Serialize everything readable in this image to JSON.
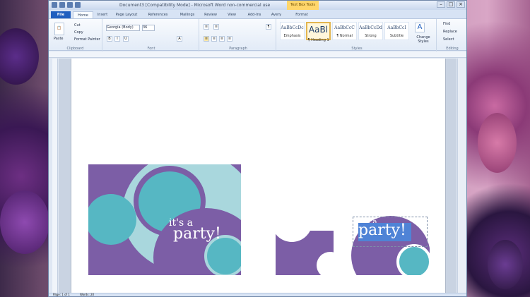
{
  "window": {
    "title": "Document3 [Compatibility Mode] - Microsoft Word non-commercial use",
    "contextual_tab": "Text Box Tools"
  },
  "tabs": [
    "File",
    "Home",
    "Insert",
    "Page Layout",
    "References",
    "Mailings",
    "Review",
    "View",
    "Add-Ins",
    "Avery",
    "Format"
  ],
  "ribbon": {
    "clipboard": {
      "paste": "Paste",
      "cut": "Cut",
      "copy": "Copy",
      "format_painter": "Format Painter",
      "group": "Clipboard"
    },
    "font": {
      "name": "Georgia (Body)",
      "size": "36",
      "group": "Font"
    },
    "paragraph": {
      "group": "Paragraph"
    },
    "styles": {
      "items": [
        {
          "sample": "AaBbCcDc",
          "name": "Emphasis"
        },
        {
          "sample": "AaBl",
          "name": "¶ Heading 1"
        },
        {
          "sample": "AaBbCcC",
          "name": "¶ Normal"
        },
        {
          "sample": "AaBbCcDd",
          "name": "Strong"
        },
        {
          "sample": "AaBbCcI",
          "name": "Subtitle"
        }
      ],
      "change_styles": "Change Styles",
      "group": "Styles"
    },
    "editing": {
      "find": "Find",
      "replace": "Replace",
      "select": "Select",
      "group": "Editing"
    }
  },
  "document": {
    "invitation_text_small": "it's a",
    "invitation_text_large": "party!"
  },
  "status": {
    "page": "Page: 1 of 1",
    "words": "Words: 20"
  },
  "colors": {
    "purple": "#7c5ea6",
    "teal": "#56b7c3",
    "light_teal": "#a9d7dd",
    "selection": "#4f83d6"
  }
}
